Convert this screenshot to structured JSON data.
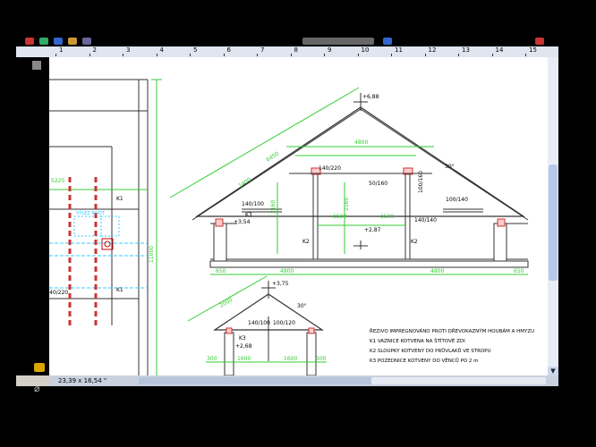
{
  "ruler": {
    "marks": [
      "1",
      "2",
      "3",
      "4",
      "5",
      "6",
      "7",
      "8",
      "9",
      "10",
      "11",
      "12",
      "13",
      "14",
      "15"
    ]
  },
  "status": {
    "page_size": "23,39 x 16,54 \""
  },
  "drawing": {
    "heights": {
      "ridge": "+6,88",
      "floor": "+2,87",
      "small_ridge": "+3,75",
      "left_plate": "+3,54",
      "small_plate": "+2,68"
    },
    "dims": {
      "rafter": "6450",
      "top": "4800",
      "collar": "50/160",
      "upper_rafter": "1400",
      "beam_a": "140/220",
      "beam_b": "100/160",
      "rafter_section": "100/140",
      "plate_left": "140/100",
      "plate_right": "140/140",
      "k3": "K3",
      "k2": "K2",
      "k2b": "K2",
      "k1": "K1",
      "k1b": "K1",
      "span1": "1500",
      "span2": "1500",
      "post_h": "2160",
      "post_h2": "2160",
      "bottom_left": "650",
      "bottom_mid1": "4800",
      "bottom_mid2": "4800",
      "bottom_right": "650",
      "angle": "30°",
      "angle2": "30°",
      "total_h": "11000",
      "side_w": "5225",
      "side_label": "40/220",
      "vylez": "VÝLEZ  ROOT",
      "sm_rafter": "2000",
      "sm_beam1": "140/100",
      "sm_beam2": "100/120",
      "sm_left": "300",
      "sm_mid1": "1600",
      "sm_mid2": "1600",
      "sm_right": "300",
      "sm_k3": "K3"
    },
    "legend": {
      "title": "ŘEZIVO IMPREGNOVÁNO PROTI DŘEVOKAZNÝM HOUBÁM A HMYZU",
      "k1": "K1   VAZNICE KOTVENA NA ŠTÍTOVÉ ZDI",
      "k2": "K2   SLOUPKY KOTVENY DO PRŮVLAKŮ VE STROPU",
      "k3": "K3   POZEDNICE KOTVENY DO VĚNCŮ PO 2 m"
    }
  }
}
